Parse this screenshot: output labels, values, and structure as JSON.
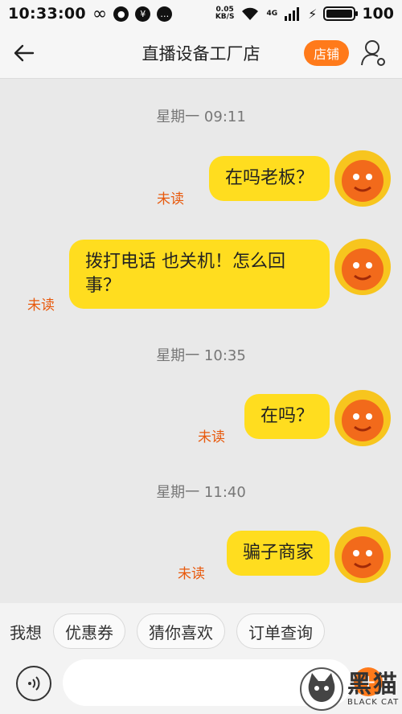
{
  "status_bar": {
    "time": "10:33:00",
    "net_speed_value": "0.05",
    "net_speed_unit": "KB/S",
    "network_type": "4G",
    "battery": "100"
  },
  "header": {
    "title": "直播设备工厂店",
    "shop_button": "店铺"
  },
  "messages": [
    {
      "timestamp": "星期一 09:11",
      "text": "在吗老板？",
      "status": "未读"
    },
    {
      "text_line1": "拨打电话 也关机！怎么回",
      "text_line2": "事？",
      "status": "未读"
    },
    {
      "timestamp": "星期一 10:35",
      "text": "在吗？",
      "status": "未读"
    },
    {
      "timestamp": "星期一 11:40",
      "text": "骗子商家",
      "status": "未读"
    }
  ],
  "quick_bar": {
    "label": "我想",
    "chips": [
      "优惠券",
      "猜你喜欢",
      "订单查询"
    ]
  },
  "input": {
    "placeholder": ""
  },
  "watermark": {
    "cn": "黑猫",
    "en": "BLACK CAT"
  },
  "colors": {
    "accent": "#ff7a1a",
    "bubble": "#ffdd1f",
    "unread": "#e8590c"
  }
}
